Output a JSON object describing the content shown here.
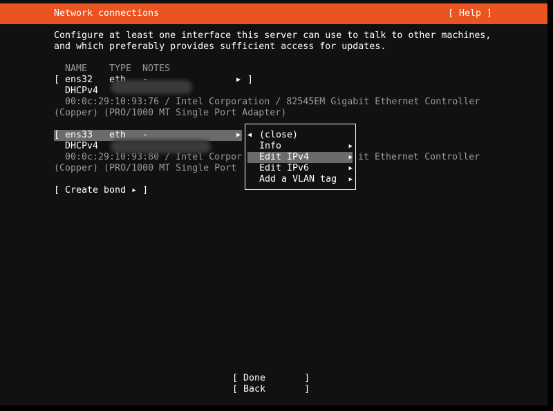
{
  "header": {
    "title": "Network connections",
    "help": "[ Help ]"
  },
  "description": [
    "Configure at least one interface this server can use to talk to other machines,",
    "and which preferably provides sufficient access for updates."
  ],
  "table": {
    "columns": [
      "NAME",
      "TYPE",
      "NOTES"
    ],
    "interfaces": [
      {
        "name": "ens32",
        "type": "eth",
        "notes": "-",
        "address": "DHCPv4",
        "mac_line": "00:0c:29:10:93:76 / Intel Corporation / 82545EM Gigabit Ethernet Controller",
        "detail_line": "(Copper) (PRO/1000 MT Single Port Adapter)"
      },
      {
        "name": "ens33",
        "type": "eth",
        "notes": "-",
        "address": "DHCPv4",
        "mac_line": "00:0c:29:10:93:80 / Intel Corpor",
        "mac_line_tail": "it Ethernet Controller",
        "detail_line": "(Copper) (PRO/1000 MT Single Port"
      }
    ]
  },
  "create_bond": "[ Create bond ▸ ]",
  "menu": {
    "items": [
      {
        "label": "(close)",
        "arrow": "◂"
      },
      {
        "label": "Info",
        "arrow": "▸"
      },
      {
        "label": "Edit IPv4",
        "arrow": "▸",
        "selected": true
      },
      {
        "label": "Edit IPv6",
        "arrow": "▸"
      },
      {
        "label": "Add a VLAN tag",
        "arrow": "▸"
      }
    ]
  },
  "buttons": {
    "done": "[ Done       ]",
    "back": "[ Back       ]"
  },
  "colors": {
    "header": "#e95420",
    "background": "#111111",
    "highlight": "#6b6b6b"
  }
}
